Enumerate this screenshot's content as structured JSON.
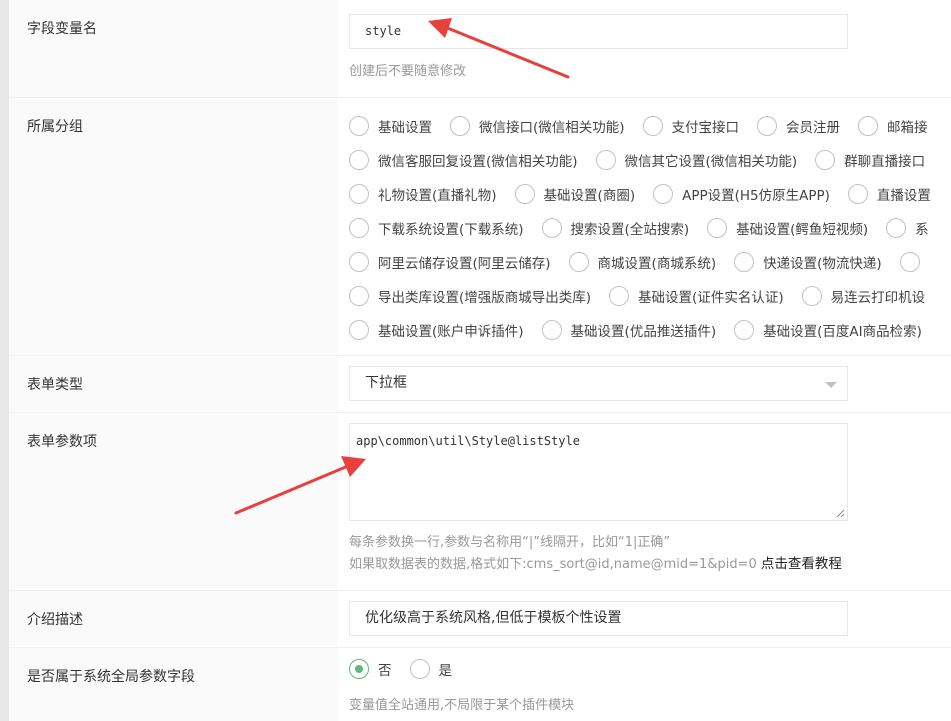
{
  "form": {
    "field_name": {
      "label": "字段变量名",
      "value": "style",
      "hint": "创建后不要随意修改"
    },
    "group": {
      "label": "所属分组",
      "lines": [
        [
          "基础设置",
          "微信接口(微信相关功能)",
          "支付宝接口",
          "会员注册",
          "邮箱接"
        ],
        [
          "微信客服回复设置(微信相关功能)",
          "微信其它设置(微信相关功能)",
          "群聊直播接口"
        ],
        [
          "礼物设置(直播礼物)",
          "基础设置(商圈)",
          "APP设置(H5仿原生APP)",
          "直播设置"
        ],
        [
          "下载系统设置(下载系统)",
          "搜索设置(全站搜索)",
          "基础设置(鳄鱼短视频)",
          "系"
        ],
        [
          "阿里云储存设置(阿里云储存)",
          "商城设置(商城系统)",
          "快递设置(物流快递)",
          ""
        ],
        [
          "导出类库设置(增强版商城导出类库)",
          "基础设置(证件实名认证)",
          "易连云打印机设"
        ],
        [
          "基础设置(账户申诉插件)",
          "基础设置(优品推送插件)",
          "基础设置(百度AI商品检索)"
        ]
      ]
    },
    "form_type": {
      "label": "表单类型",
      "value": "下拉框"
    },
    "form_params": {
      "label": "表单参数项",
      "value": "app\\common\\util\\Style@listStyle",
      "hint1": "每条参数换一行,参数与名称用“|”线隔开，比如“1|正确”",
      "hint2": "如果取数据表的数据,格式如下:cms_sort@id,name@mid=1&pid=0",
      "tutorial_link": "点击查看教程"
    },
    "description": {
      "label": "介绍描述",
      "value": "优化级高于系统风格,但低于模板个性设置"
    },
    "global_param": {
      "label": "是否属于系统全局参数字段",
      "options": [
        "否",
        "是"
      ],
      "selected": "否",
      "hint": "变量值全站通用,不局限于某个插件模块"
    }
  },
  "colors": {
    "accent_green": "#5FB878",
    "annotation_red": "#e8403a"
  }
}
